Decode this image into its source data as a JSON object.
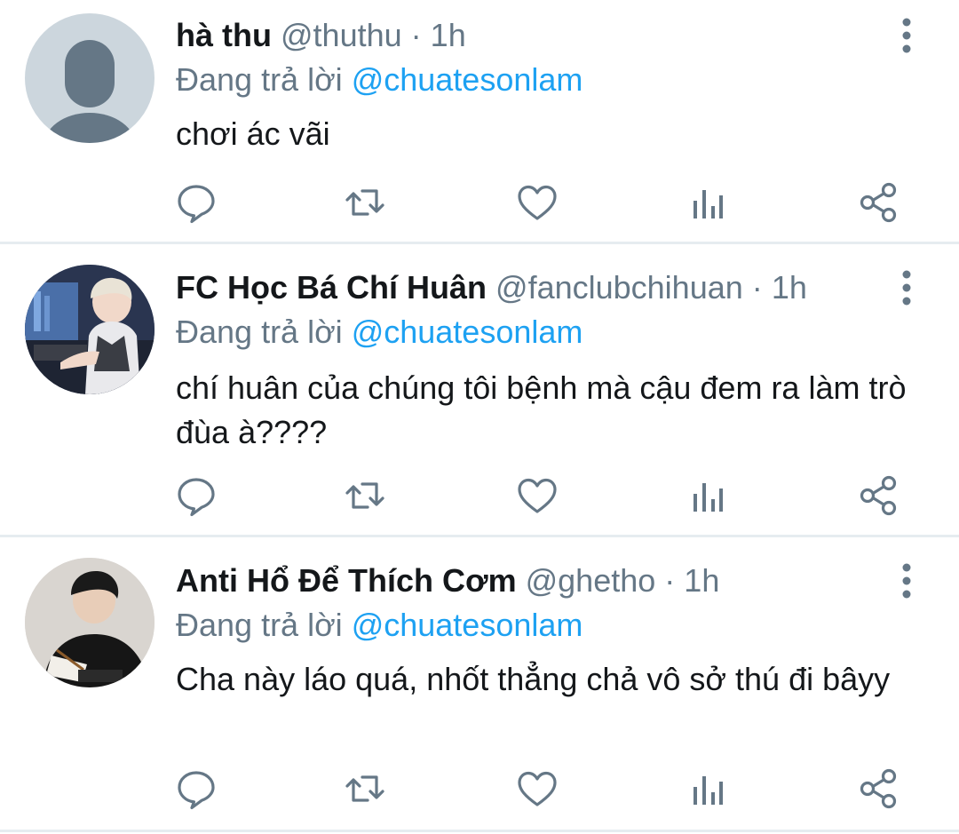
{
  "tweets": [
    {
      "display_name": "hà thu",
      "handle": "@thuthu",
      "separator": "·",
      "time": "1h",
      "reply_prefix": "Đang trả lời ",
      "reply_to": "@chuatesonlam",
      "text": "chơi ác vãi"
    },
    {
      "display_name": "FC Học Bá Chí Huân",
      "handle": "@fanclubchihuan",
      "separator": "·",
      "time": "1h",
      "reply_prefix": "Đang trả lời ",
      "reply_to": "@chuatesonlam",
      "text": "chí huân của chúng tôi bệnh mà cậu đem ra làm trò đùa à????"
    },
    {
      "display_name": "Anti Hổ Để Thích Cơm",
      "handle": "@ghetho",
      "separator": "·",
      "time": "1h",
      "reply_prefix": "Đang trả lời ",
      "reply_to": "@chuatesonlam",
      "text": "Cha này láo quá, nhốt thẳng chả vô sở thú đi bâyy"
    }
  ],
  "actions": [
    "reply-icon",
    "retweet-icon",
    "like-icon",
    "analytics-icon",
    "share-icon"
  ],
  "colors": {
    "accent": "#1da1f2",
    "secondary_text": "#657786",
    "divider": "#e6ecf0",
    "icon": "#657786"
  }
}
